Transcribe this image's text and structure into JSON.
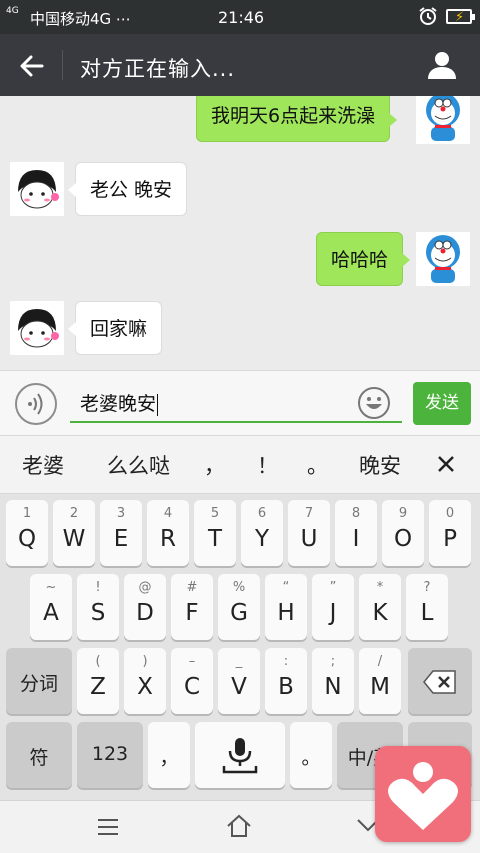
{
  "status_bar": {
    "signal_label": "4G",
    "carrier": "中国移动4G ⋯",
    "time": "21:46"
  },
  "title_bar": {
    "title": "对方正在输入..."
  },
  "messages": [
    {
      "side": "right",
      "text": "我明天6点起来洗澡"
    },
    {
      "side": "left",
      "text": "老公 晚安"
    },
    {
      "side": "right",
      "text": "哈哈哈"
    },
    {
      "side": "left",
      "text": "回家嘛"
    }
  ],
  "input": {
    "value": "老婆晚安",
    "send_label": "发送"
  },
  "candidates": [
    "老婆",
    "么么哒",
    "，",
    "！",
    "。",
    "晚安"
  ],
  "keyboard": {
    "row1": [
      {
        "sub": "1",
        "main": "Q"
      },
      {
        "sub": "2",
        "main": "W"
      },
      {
        "sub": "3",
        "main": "E"
      },
      {
        "sub": "4",
        "main": "R"
      },
      {
        "sub": "5",
        "main": "T"
      },
      {
        "sub": "6",
        "main": "Y"
      },
      {
        "sub": "7",
        "main": "U"
      },
      {
        "sub": "8",
        "main": "I"
      },
      {
        "sub": "9",
        "main": "O"
      },
      {
        "sub": "0",
        "main": "P"
      }
    ],
    "row2": [
      {
        "sub": "~",
        "main": "A"
      },
      {
        "sub": "!",
        "main": "S"
      },
      {
        "sub": "@",
        "main": "D"
      },
      {
        "sub": "#",
        "main": "F"
      },
      {
        "sub": "%",
        "main": "G"
      },
      {
        "sub": "“",
        "main": "H"
      },
      {
        "sub": "”",
        "main": "J"
      },
      {
        "sub": "*",
        "main": "K"
      },
      {
        "sub": "?",
        "main": "L"
      }
    ],
    "row3_left": "分词",
    "row3": [
      {
        "sub": "(",
        "main": "Z"
      },
      {
        "sub": ")",
        "main": "X"
      },
      {
        "sub": "–",
        "main": "C"
      },
      {
        "sub": "_",
        "main": "V"
      },
      {
        "sub": ":",
        "main": "B"
      },
      {
        "sub": ";",
        "main": "N"
      },
      {
        "sub": "/",
        "main": "M"
      }
    ],
    "row4": {
      "symbol": "符",
      "numeric": "123",
      "comma": "，",
      "period": "。",
      "lang": "中/英"
    }
  },
  "colors": {
    "accent_green": "#4cb33c",
    "bubble_green": "#9fe65a",
    "header": "#393a3f",
    "overlay_pink": "#f06f7b"
  }
}
